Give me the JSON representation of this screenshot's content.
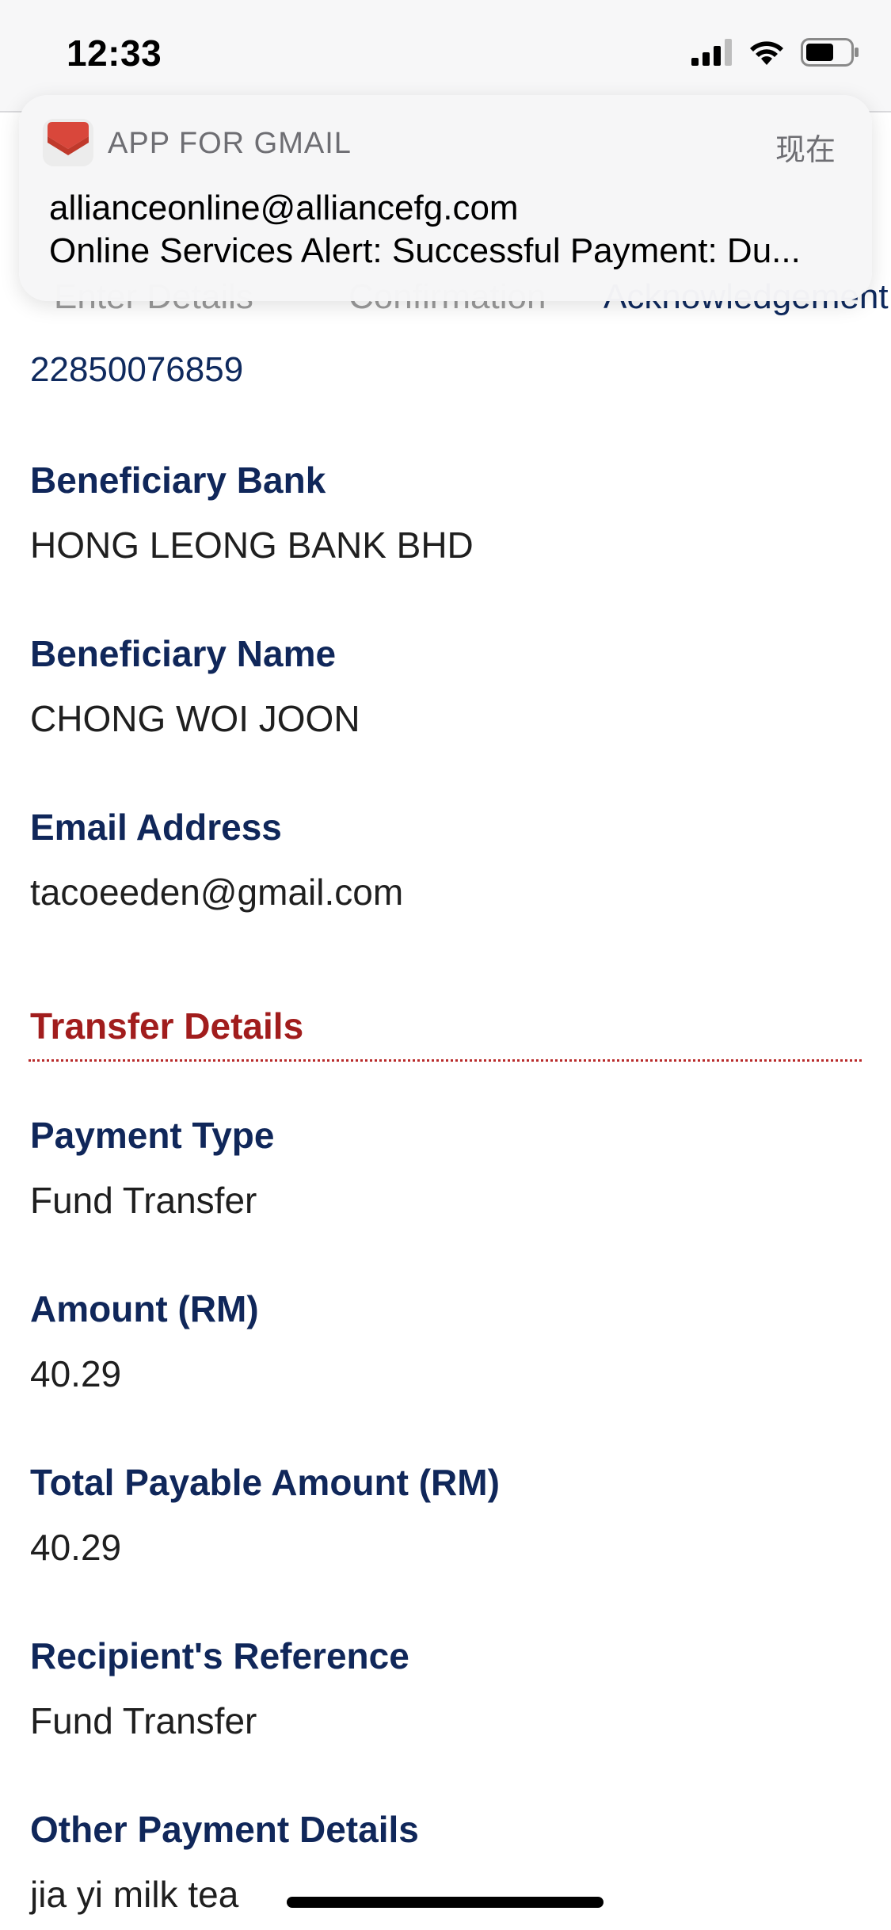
{
  "status_bar": {
    "time": "12:33",
    "icons": [
      "signal-icon",
      "wifi-icon",
      "battery-icon"
    ]
  },
  "steps": {
    "step1": "Enter Details",
    "step2": "Confirmation",
    "step3": "Acknowledgement"
  },
  "notification": {
    "app_name": "APP FOR GMAIL",
    "time": "现在",
    "sender": "allianceonline@alliancefg.com",
    "body": "Online Services Alert: Successful Payment: Du..."
  },
  "account_number": "22850076859",
  "beneficiary": {
    "bank_label": "Beneficiary Bank",
    "bank_value": "HONG LEONG BANK BHD",
    "name_label": "Beneficiary Name",
    "name_value": "CHONG WOI JOON",
    "email_label": "Email Address",
    "email_value": "tacoeeden@gmail.com"
  },
  "transfer": {
    "section_title": "Transfer Details",
    "payment_type_label": "Payment Type",
    "payment_type_value": "Fund Transfer",
    "amount_label": "Amount (RM)",
    "amount_value": "40.29",
    "total_label": "Total Payable Amount (RM)",
    "total_value": "40.29",
    "reference_label": "Recipient's Reference",
    "reference_value": "Fund Transfer",
    "other_label": "Other Payment Details",
    "other_value": "jia yi milk tea"
  },
  "colors": {
    "label": "#10275a",
    "section": "#a11d1d",
    "link": "#0f2a5e"
  }
}
